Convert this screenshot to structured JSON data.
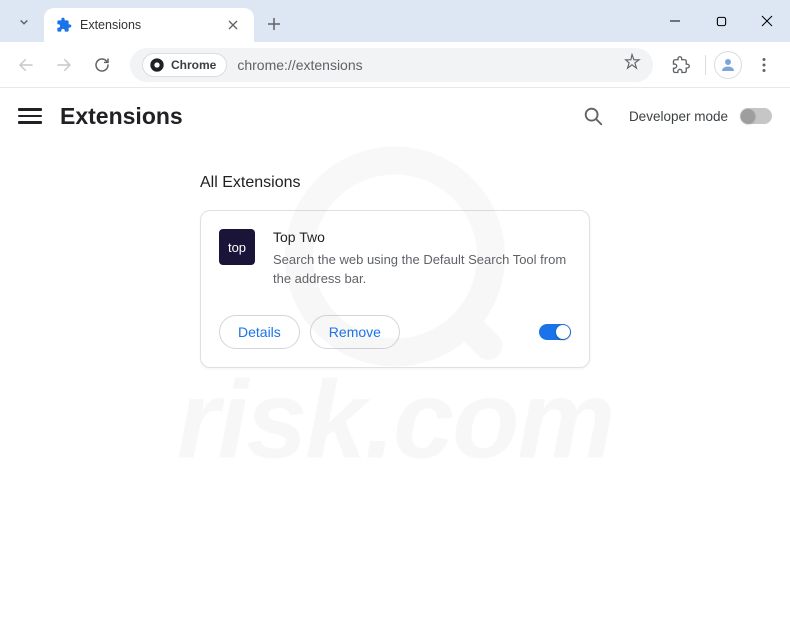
{
  "titlebar": {
    "tab_title": "Extensions"
  },
  "toolbar": {
    "chrome_label": "Chrome",
    "url": "chrome://extensions"
  },
  "header": {
    "title": "Extensions",
    "dev_mode_label": "Developer mode"
  },
  "section": {
    "title": "All Extensions"
  },
  "extension": {
    "icon_text": "top",
    "name": "Top Two",
    "description": "Search the web using the Default Search Tool from the address bar.",
    "details_label": "Details",
    "remove_label": "Remove"
  },
  "watermark": {
    "text": "risk.com"
  }
}
